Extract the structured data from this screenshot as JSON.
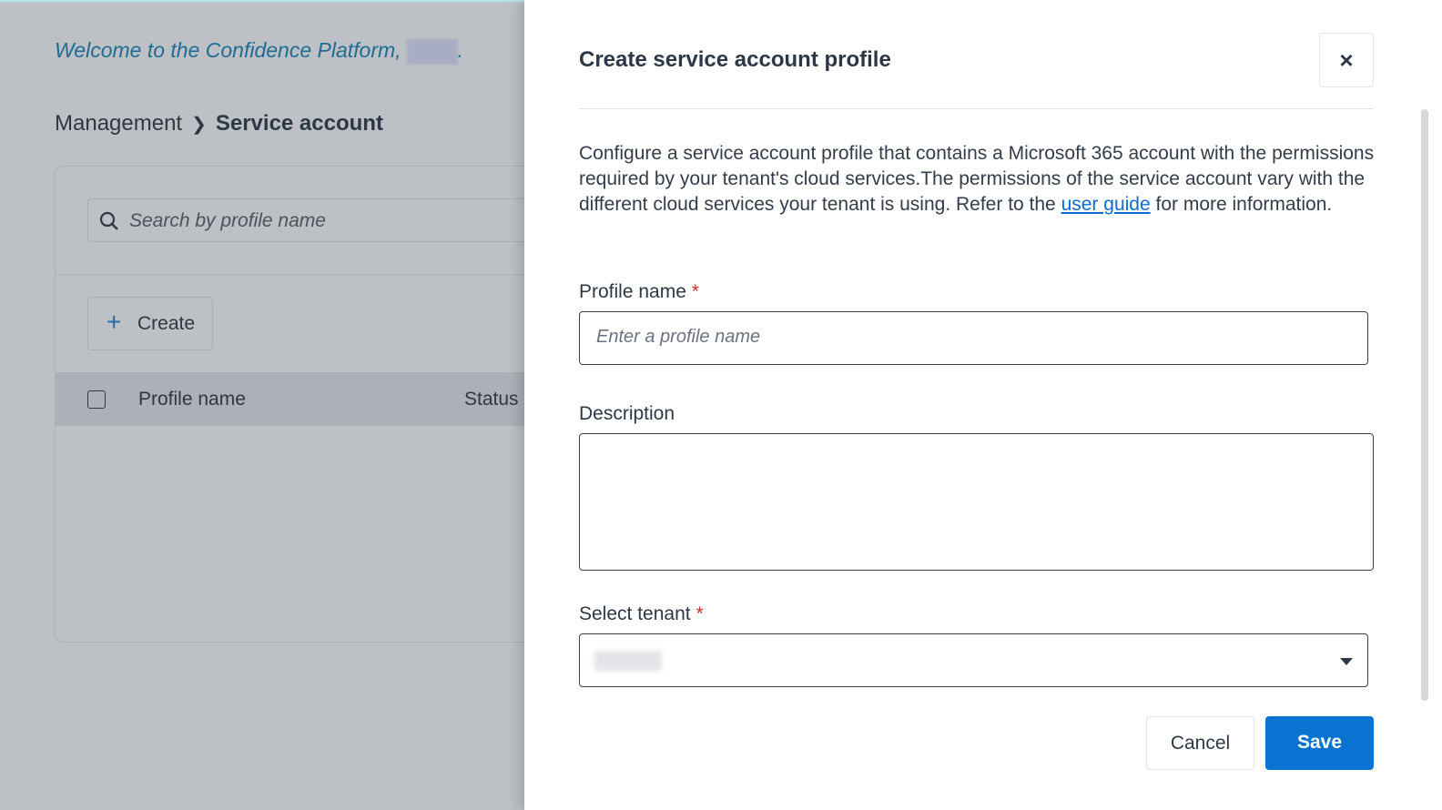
{
  "background": {
    "welcome": "Welcome to the Confidence Platform,",
    "welcome_suffix": ".",
    "breadcrumb": {
      "parent": "Management",
      "current": "Service account"
    },
    "search_placeholder": "Search by profile name",
    "create_label": "Create",
    "columns": [
      "Profile name",
      "Status"
    ]
  },
  "panel": {
    "title": "Create service account profile",
    "close_icon": "×",
    "description_before": "Configure a service account profile that contains a Microsoft 365 account with the permissions required by your tenant's cloud services.The permissions of the service account vary with the different cloud services your tenant is using. Refer to the ",
    "link": "user guide",
    "description_after": " for more information.",
    "profile_label": "Profile name",
    "profile_placeholder": "Enter a profile name",
    "description_label": "Description",
    "tenant_label": "Select tenant",
    "required_mark": "*",
    "cancel": "Cancel",
    "save": "Save"
  },
  "colors": {
    "accent": "#0873d1",
    "required": "#d0312d"
  }
}
